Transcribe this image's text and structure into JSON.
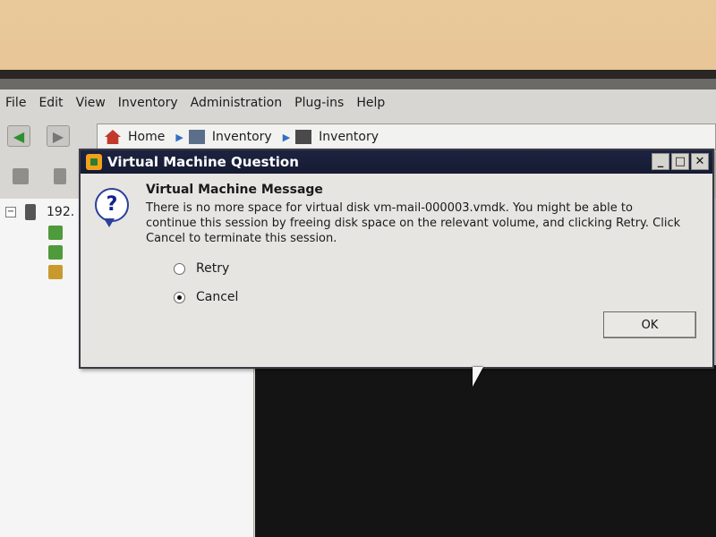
{
  "menubar": {
    "items": [
      "File",
      "Edit",
      "View",
      "Inventory",
      "Administration",
      "Plug-ins",
      "Help"
    ]
  },
  "breadcrumb": {
    "items": [
      "Home",
      "Inventory",
      "Inventory"
    ]
  },
  "tree": {
    "host_label": "192."
  },
  "dialog": {
    "title": "Virtual Machine Question",
    "message_title": "Virtual Machine Message",
    "message_body": "There is no more space for virtual disk vm-mail-000003.vmdk. You might be able to continue this session by freeing disk space on the relevant volume, and clicking Retry. Click Cancel to terminate this session.",
    "options": [
      {
        "label": "Retry",
        "selected": false
      },
      {
        "label": "Cancel",
        "selected": true
      }
    ],
    "ok_label": "OK",
    "window_buttons": {
      "minimize": "_",
      "maximize": "□",
      "close": "✕"
    }
  },
  "colors": {
    "title_bar": "#1d2340",
    "dialog_bg": "#e6e5e2",
    "console_bg": "#141414"
  },
  "icons": {
    "question": "?",
    "back_arrow": "◀",
    "forward_arrow": "▶"
  }
}
